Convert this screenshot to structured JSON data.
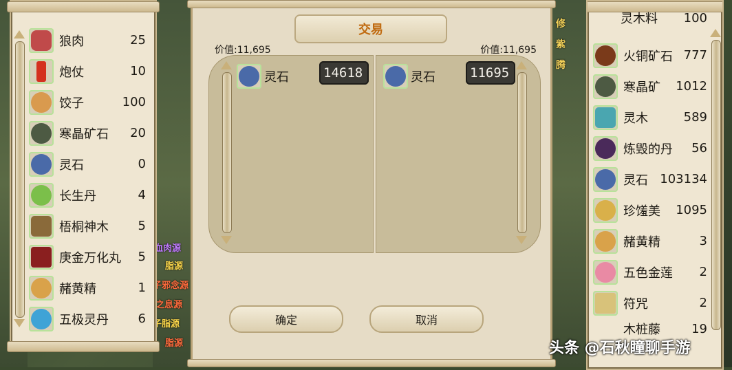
{
  "left_inventory": {
    "items": [
      {
        "name": "狼肉",
        "qty": "25",
        "icon": "meat-icon"
      },
      {
        "name": "炮仗",
        "qty": "10",
        "icon": "firecracker-icon"
      },
      {
        "name": "饺子",
        "qty": "100",
        "icon": "dumpling-icon"
      },
      {
        "name": "寒晶矿石",
        "qty": "20",
        "icon": "ore-icon"
      },
      {
        "name": "灵石",
        "qty": "0",
        "icon": "spirit-stone-icon"
      },
      {
        "name": "长生丹",
        "qty": "4",
        "icon": "gourd-icon"
      },
      {
        "name": "梧桐神木",
        "qty": "5",
        "icon": "wood-icon"
      },
      {
        "name": "庚金万化丸",
        "qty": "5",
        "icon": "pill-box-icon"
      },
      {
        "name": "赭黄精",
        "qty": "1",
        "icon": "ginseng-icon"
      },
      {
        "name": "五极灵丹",
        "qty": "6",
        "icon": "blue-gourd-icon"
      }
    ]
  },
  "trade": {
    "title": "交易",
    "left_value_label": "价值:11,695",
    "right_value_label": "价值:11,695",
    "left_offer": {
      "name": "灵石",
      "qty": "14618",
      "icon": "spirit-stone-icon"
    },
    "right_offer": {
      "name": "灵石",
      "qty": "11695",
      "icon": "spirit-stone-icon"
    },
    "confirm_label": "确定",
    "cancel_label": "取消"
  },
  "right_inventory": {
    "items": [
      {
        "name": "火铜矿石",
        "qty": "777",
        "icon": "copper-ore-icon"
      },
      {
        "name": "寒晶矿",
        "qty": "1012",
        "icon": "ore-icon"
      },
      {
        "name": "灵木",
        "qty": "589",
        "icon": "spirit-wood-icon"
      },
      {
        "name": "炼毁的丹",
        "qty": "56",
        "icon": "dark-pill-icon"
      },
      {
        "name": "灵石",
        "qty": "103134",
        "icon": "spirit-stone-icon"
      },
      {
        "name": "珍馐美",
        "qty": "1095",
        "icon": "food-bowl-icon"
      },
      {
        "name": "赭黄精",
        "qty": "3",
        "icon": "ginseng-icon"
      },
      {
        "name": "五色金莲",
        "qty": "2",
        "icon": "lotus-icon"
      },
      {
        "name": "符咒",
        "qty": "2",
        "icon": "talisman-icon"
      }
    ],
    "top_partial": {
      "name": "灵木料",
      "qty": "100"
    },
    "bottom_partial": {
      "name": "木桩藤",
      "qty": "19"
    }
  },
  "background_texts": [
    "血肉源",
    "脂源",
    "子邪念源",
    "之息源",
    "子脂源",
    "脂源"
  ],
  "side_labels": [
    "修",
    "紫",
    "腾"
  ],
  "watermark": "头条 @石秋瞳聊手游"
}
